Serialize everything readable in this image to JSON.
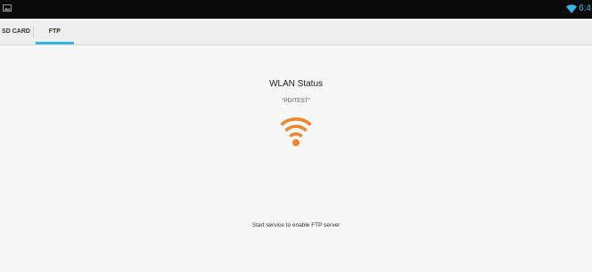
{
  "status_bar": {
    "time": "6:4",
    "left_icon": "gallery-icon",
    "wifi_icon": "wifi-signal-icon",
    "time_color": "#33b5e5"
  },
  "tabs": [
    {
      "label": "SD CARD",
      "selected": false
    },
    {
      "label": "FTP",
      "selected": true
    }
  ],
  "accent_color": "#33b5e5",
  "wlan": {
    "title": "WLAN Status",
    "ssid": "\"PDITEST\"",
    "icon": "wifi-icon",
    "icon_color": "#f0862a"
  },
  "footer": {
    "message": "Start service to enable FTP server"
  }
}
